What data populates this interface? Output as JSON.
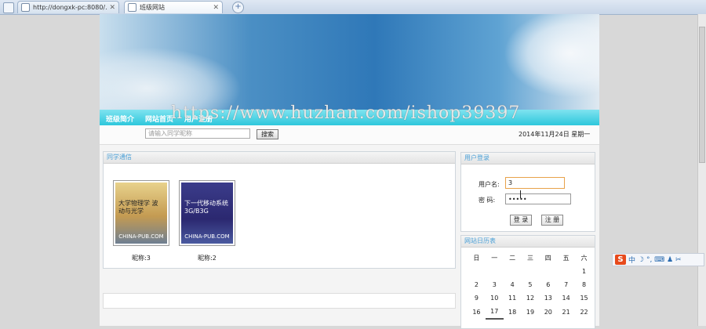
{
  "browser": {
    "tabs": [
      {
        "label": "http://dongxk-pc:8080/..."
      },
      {
        "label": "班级网站"
      }
    ],
    "new_tab_icon": "plus-icon"
  },
  "nav": {
    "items": [
      "班级简介",
      "网站首页",
      "用户注册"
    ]
  },
  "search": {
    "placeholder": "请输入同学昵称",
    "button_label": "搜索"
  },
  "date_text": "2014年11月24日 星期一",
  "classmates": {
    "title": "同学通信",
    "books": [
      {
        "cover_title": "大学物理学 波动与光学",
        "cover_footer": "CHINA-PUB.COM",
        "caption": "昵称:3"
      },
      {
        "cover_title": "下一代移动系统 3G/B3G",
        "cover_footer": "CHINA-PUB.COM",
        "caption": "昵称:2"
      }
    ]
  },
  "login": {
    "title": "用户登录",
    "username_label": "用户名:",
    "username_value": "3",
    "password_label": "密  码:",
    "password_value": "•••••",
    "login_button": "登 录",
    "register_button": "注 册"
  },
  "calendar": {
    "title": "网站日历表",
    "weekdays": [
      "日",
      "一",
      "二",
      "三",
      "四",
      "五",
      "六"
    ],
    "weeks": [
      [
        "",
        "",
        "",
        "",
        "",
        "",
        "1"
      ],
      [
        "2",
        "3",
        "4",
        "5",
        "6",
        "7",
        "8"
      ],
      [
        "9",
        "10",
        "11",
        "12",
        "13",
        "14",
        "15"
      ],
      [
        "16",
        "17",
        "18",
        "19",
        "20",
        "21",
        "22"
      ]
    ]
  },
  "watermark": "https://www.huzhan.com/ishop39397",
  "ime": {
    "logo": "S",
    "mode": "中",
    "icons": "☽ °, ⌨ ♟ ✂"
  }
}
